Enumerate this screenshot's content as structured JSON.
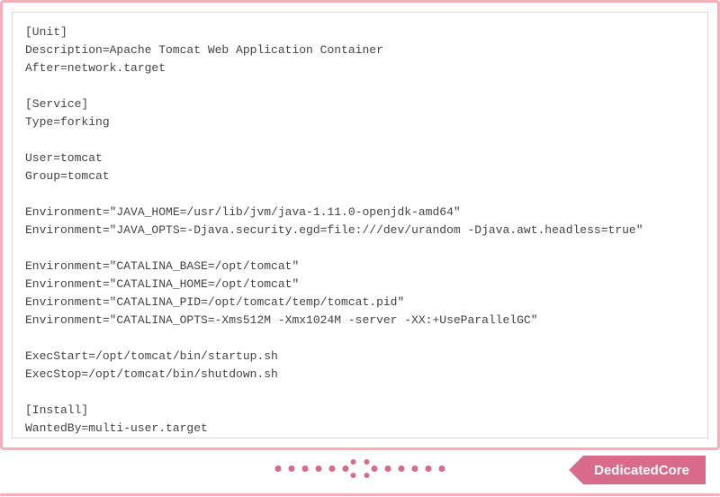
{
  "badge_label": "DedicatedCore",
  "config_lines": [
    "[Unit]",
    "Description=Apache Tomcat Web Application Container",
    "After=network.target",
    "",
    "[Service]",
    "Type=forking",
    "",
    "User=tomcat",
    "Group=tomcat",
    "",
    "Environment=\"JAVA_HOME=/usr/lib/jvm/java-1.11.0-openjdk-amd64\"",
    "Environment=\"JAVA_OPTS=-Djava.security.egd=file:///dev/urandom -Djava.awt.headless=true\"",
    "",
    "Environment=\"CATALINA_BASE=/opt/tomcat\"",
    "Environment=\"CATALINA_HOME=/opt/tomcat\"",
    "Environment=\"CATALINA_PID=/opt/tomcat/temp/tomcat.pid\"",
    "Environment=\"CATALINA_OPTS=-Xms512M -Xmx1024M -server -XX:+UseParallelGC\"",
    "",
    "ExecStart=/opt/tomcat/bin/startup.sh",
    "ExecStop=/opt/tomcat/bin/shutdown.sh",
    "",
    "[Install]",
    "WantedBy=multi-user.target"
  ]
}
